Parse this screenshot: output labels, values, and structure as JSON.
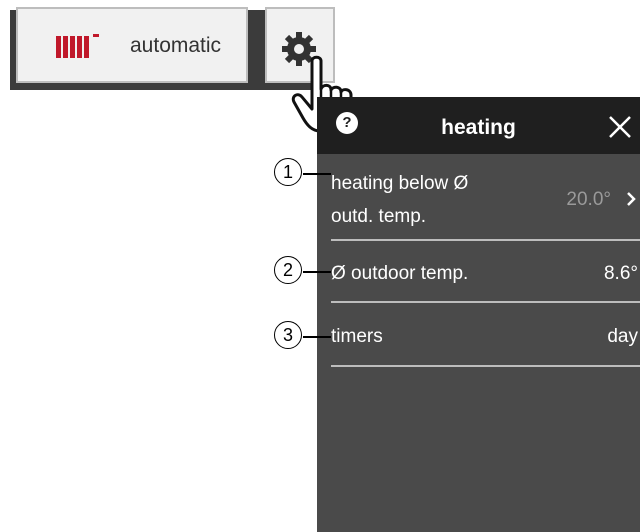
{
  "toolbar": {
    "mode_label": "automatic",
    "icons": {
      "radiator": "radiator-icon",
      "settings": "gear-icon",
      "pointer": "hand-pointer-icon"
    }
  },
  "panel": {
    "title": "heating",
    "help_glyph": "?",
    "rows": [
      {
        "label_line1": "heating below Ø",
        "label_line2": "outd. temp.",
        "value": "20.0°",
        "value_state": "muted",
        "has_chevron": true
      },
      {
        "label": "Ø outdoor temp.",
        "value": "8.6°"
      },
      {
        "label": "timers",
        "value": "day"
      }
    ]
  },
  "callouts": [
    "1",
    "2",
    "3"
  ],
  "colors": {
    "toolbar_bg": "#3b3b3b",
    "button_bg": "#f1f1f1",
    "radiator_red": "#c0182a",
    "panel_bg": "#4a4a4a",
    "panel_header_bg": "#1f1f1f",
    "divider": "#bdbdbd"
  }
}
